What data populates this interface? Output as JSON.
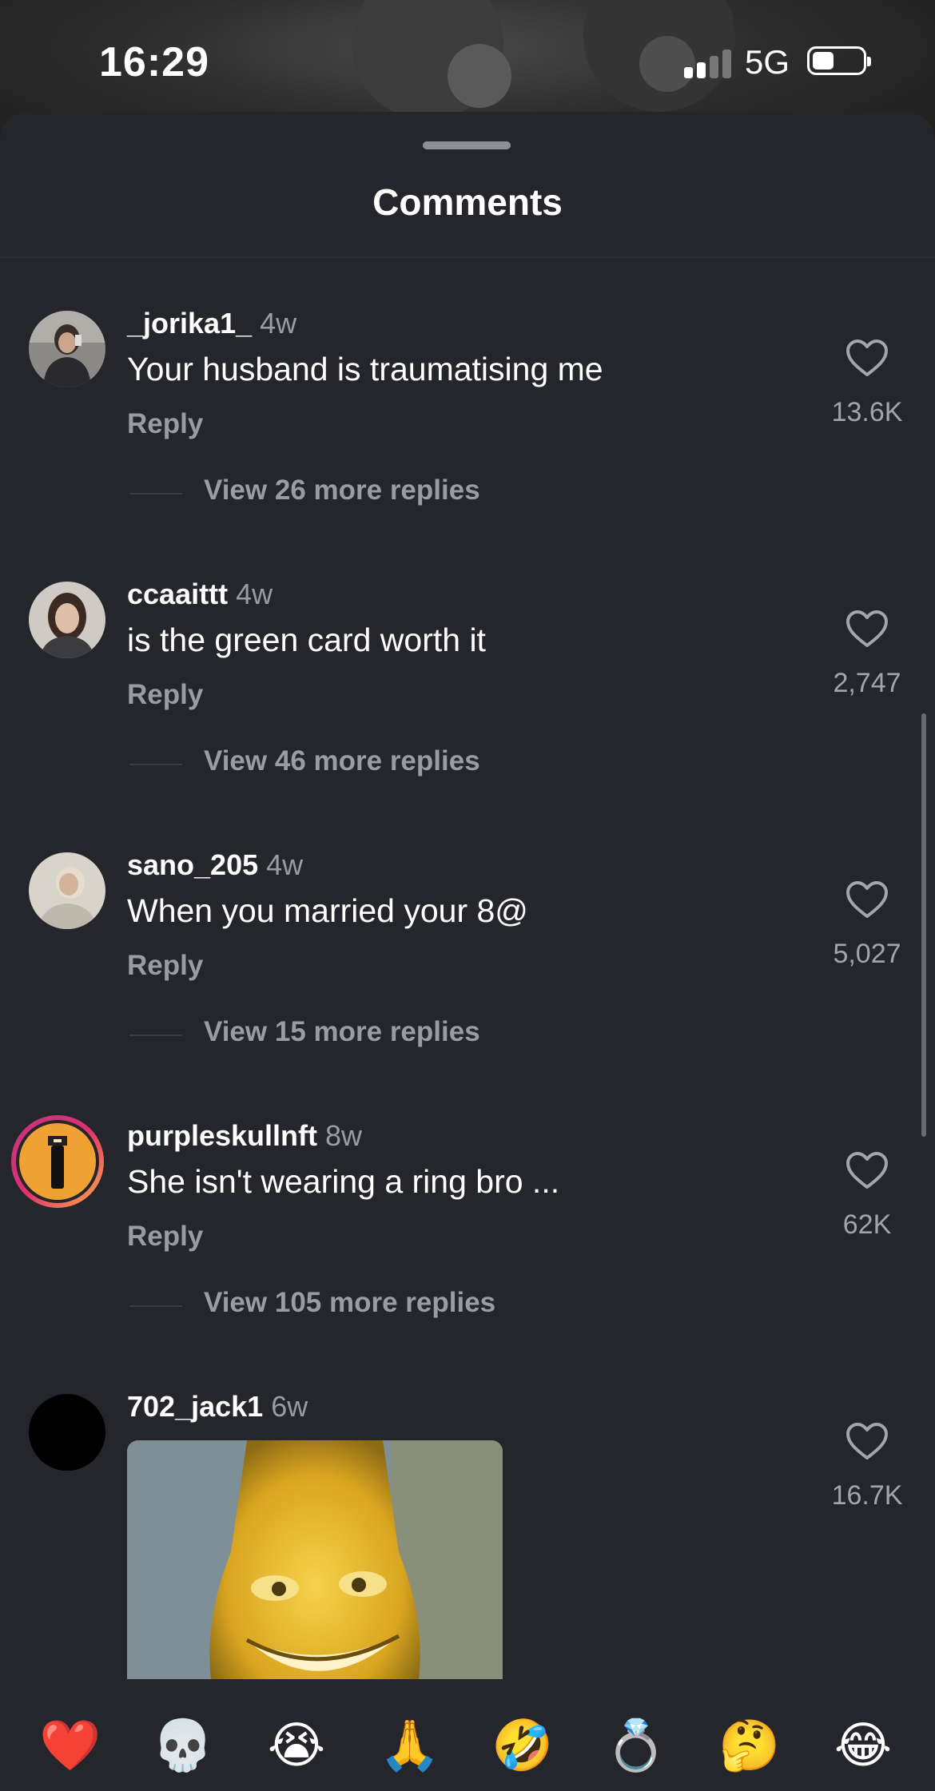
{
  "status_bar": {
    "time": "16:29",
    "network": "5G"
  },
  "sheet": {
    "title": "Comments"
  },
  "comments": [
    {
      "username": "_jorika1_",
      "age": "4w",
      "text": "Your husband is traumatising me",
      "reply_label": "Reply",
      "likes": "13.6K",
      "view_more": "View 26 more replies"
    },
    {
      "username": "ccaaittt",
      "age": "4w",
      "text": "is the green card worth it",
      "reply_label": "Reply",
      "likes": "2,747",
      "view_more": "View 46 more replies"
    },
    {
      "username": "sano_205",
      "age": "4w",
      "text": "When you married your 8@",
      "reply_label": "Reply",
      "likes": "5,027",
      "view_more": "View 15 more replies"
    },
    {
      "username": "purpleskullnft",
      "age": "8w",
      "text": "She isn't wearing a ring bro ...",
      "reply_label": "Reply",
      "likes": "62K",
      "view_more": "View 105 more replies"
    },
    {
      "username": "702_jack1",
      "age": "6w",
      "likes": "16.7K",
      "media": "gif-image"
    }
  ],
  "emoji_bar": [
    {
      "emoji": "❤️",
      "name": "heart"
    },
    {
      "emoji": "💀",
      "name": "skull"
    },
    {
      "emoji": "😭",
      "name": "loudly-crying"
    },
    {
      "emoji": "🙏",
      "name": "folded-hands"
    },
    {
      "emoji": "🤣",
      "name": "rolling-laughing"
    },
    {
      "emoji": "💍",
      "name": "ring"
    },
    {
      "emoji": "🤔",
      "name": "thinking"
    },
    {
      "emoji": "😂",
      "name": "tears-of-joy"
    }
  ]
}
